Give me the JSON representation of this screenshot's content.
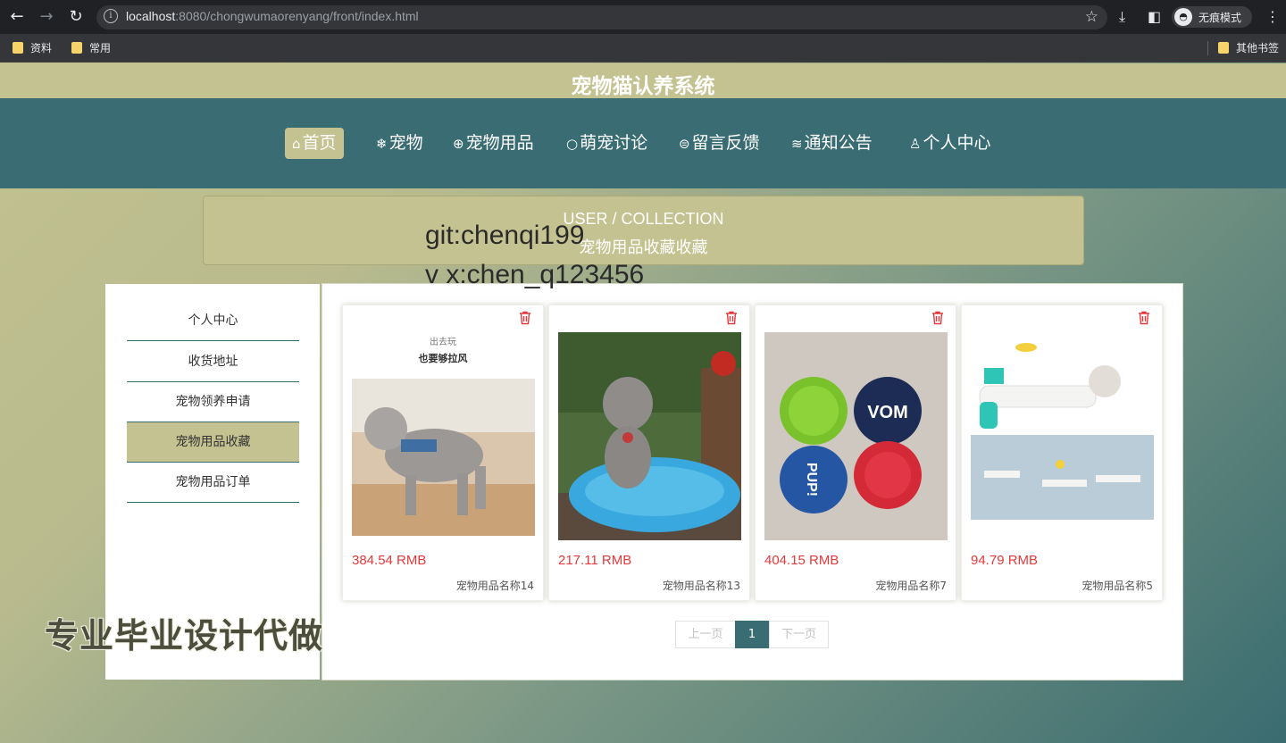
{
  "browser": {
    "url_host": "localhost",
    "url_rest": ":8080/chongwumaorenyang/front/index.html",
    "profile_label": "无痕模式",
    "bookmarks": [
      "资料",
      "常用"
    ],
    "other_bookmarks": "其他书签"
  },
  "site": {
    "title": "宠物猫认养系统",
    "nav": [
      {
        "icon": "⌂",
        "label": "首页"
      },
      {
        "icon": "❄",
        "label": "宠物"
      },
      {
        "icon": "⊕",
        "label": "宠物用品"
      },
      {
        "icon": "○",
        "label": "萌宠讨论"
      },
      {
        "icon": "⊜",
        "label": "留言反馈"
      },
      {
        "icon": "≋",
        "label": "通知公告"
      },
      {
        "icon": "♙",
        "label": "个人中心"
      }
    ]
  },
  "banner": {
    "en": "USER / COLLECTION",
    "cn": "宠物用品收藏收藏"
  },
  "watermark": {
    "line1": "git:chenqi199",
    "line2": "v x:chen_q123456",
    "promo": "专业毕业设计代做"
  },
  "sidebar": {
    "items": [
      "个人中心",
      "收货地址",
      "宠物领养申请",
      "宠物用品收藏",
      "宠物用品订单"
    ],
    "active_index": 3
  },
  "cards": [
    {
      "price": "384.54 RMB",
      "name": "宠物用品名称14",
      "img_text1": "出去玩",
      "img_text2": "也要够拉风"
    },
    {
      "price": "217.11 RMB",
      "name": "宠物用品名称13"
    },
    {
      "price": "404.15 RMB",
      "name": "宠物用品名称7",
      "img_text1": "VOM",
      "img_text2": "PUP!"
    },
    {
      "price": "94.79 RMB",
      "name": "宠物用品名称5"
    }
  ],
  "pagination": {
    "prev": "上一页",
    "current": "1",
    "next": "下一页"
  },
  "colors": {
    "accent": "#c3c290",
    "teal": "#3a6c73",
    "price": "#e4393c"
  }
}
